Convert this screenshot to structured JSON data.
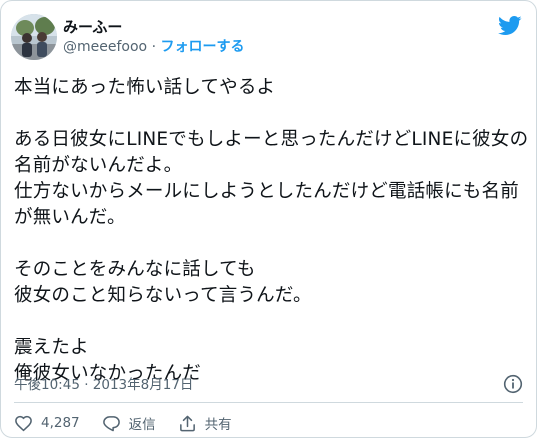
{
  "author": {
    "display_name": "みーふー",
    "handle": "@meeefooo",
    "separator": "·",
    "follow_label": "フォローする"
  },
  "icons": {
    "brand": "twitter-bird-icon",
    "info": "info-icon",
    "like": "heart-icon",
    "reply": "speech-bubble-icon",
    "share": "share-icon"
  },
  "colors": {
    "accent": "#1d9bf0",
    "text": "#0f1419",
    "muted": "#536471",
    "border": "#cfd9de"
  },
  "tweet": {
    "lines": [
      "本当にあった怖い話してやるよ",
      "ある日彼女にLINEでもしよーと思ったんだけどLINEに彼女の名前がないんだよ。\n仕方ないからメールにしようとしたんだけど電話帳にも名前が無いんだ。",
      "そのことをみんなに話しても\n彼女のこと知らないって言うんだ。",
      "震えたよ\n俺彼女いなかったんだ"
    ],
    "timestamp": "午後10:45 · 2013年8月17日"
  },
  "actions": {
    "like_count": "4,287",
    "reply_label": "返信",
    "share_label": "共有"
  }
}
